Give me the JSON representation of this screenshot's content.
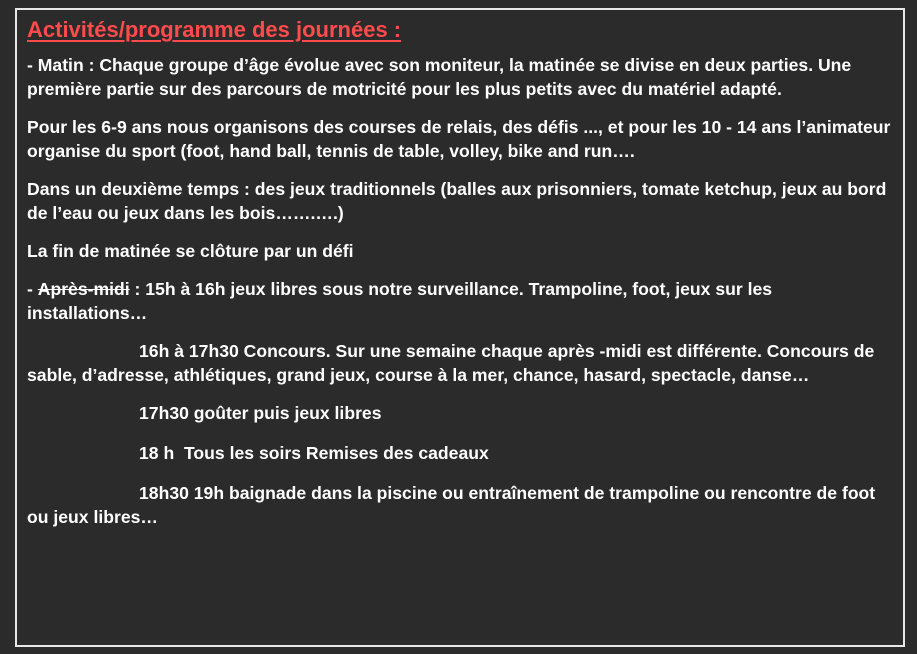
{
  "title": "Activités/programme des journées :",
  "matin": {
    "prefix": "- ",
    "label": "Matin",
    "text": " : Chaque groupe d’âge évolue avec son moniteur, la matinée se divise en deux parties. Une première partie sur des parcours de motricité pour les plus petits avec du matériel adapté."
  },
  "p_6_9": "Pour les 6-9 ans nous organisons des courses de relais, des défis ..., et pour les 10 - 14 ans l’animateur organise du sport (foot, hand ball, tennis de table, volley, bike and run….",
  "p_deuxieme": "Dans un deuxième temps : des jeux traditionnels (balles aux prisonniers, tomate ketchup, jeux au bord de l’eau ou jeux dans les bois…….….)",
  "p_fin": "La fin de matinée se clôture par un défi",
  "apres_midi": {
    "prefix": "- ",
    "label": "Après-midi",
    "sep": " : ",
    "time": "15h à 16h",
    "text": " jeux libres sous notre surveillance. Trampoline, foot, jeux sur les installations…"
  },
  "concours": {
    "time": "16h à 17h30",
    "text": " Concours. Sur une semaine chaque après -midi est différente. Concours de sable, d’adresse, athlétiques, grand jeux, course à la mer, chance, hasard, spectacle, danse…"
  },
  "gouter": {
    "time": "17h30",
    "text": " goûter puis jeux libres"
  },
  "cadeaux": {
    "time": "18 h",
    "text": "  Tous les soirs Remises des cadeaux"
  },
  "baignade": {
    "time": "18h30 19h",
    "text": " baignade dans la piscine ou entraînement de trampoline ou rencontre de foot ou jeux libres…"
  }
}
